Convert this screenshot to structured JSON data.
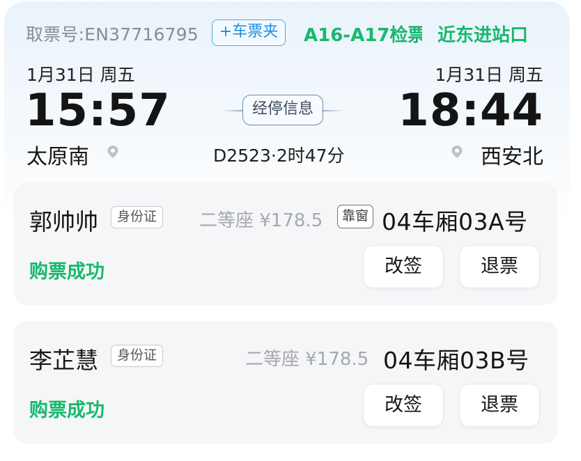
{
  "header": {
    "ticket_number": "取票号:EN37716795",
    "ticket_folder_button": "+车票夹",
    "gate": "A16-A17检票",
    "entrance": "近东进站口"
  },
  "journey": {
    "departure": {
      "date": "1月31日  周五",
      "time": "15:57",
      "station": "太原南"
    },
    "arrival": {
      "date": "1月31日  周五",
      "time": "18:44",
      "station": "西安北"
    },
    "stop_info_button": "经停信息",
    "train_info": "D2523·2时47分"
  },
  "passengers": [
    {
      "name": "郭帅帅",
      "id_type": "身份证",
      "seat_class": "二等座 ¥178.5",
      "window_tag": "靠窗",
      "seat": "04车厢03A号",
      "status": "购票成功",
      "change_label": "改签",
      "refund_label": "退票"
    },
    {
      "name": "李芷慧",
      "id_type": "身份证",
      "seat_class": "二等座 ¥178.5",
      "seat": "04车厢03B号",
      "status": "购票成功",
      "change_label": "改签",
      "refund_label": "退票"
    }
  ],
  "colors": {
    "accent_green": "#18b86d",
    "link_blue": "#1d8fe0",
    "text_dark": "#141414",
    "text_gray": "#8a8d93"
  },
  "icons": {
    "location_pin": "location-pin-icon"
  }
}
